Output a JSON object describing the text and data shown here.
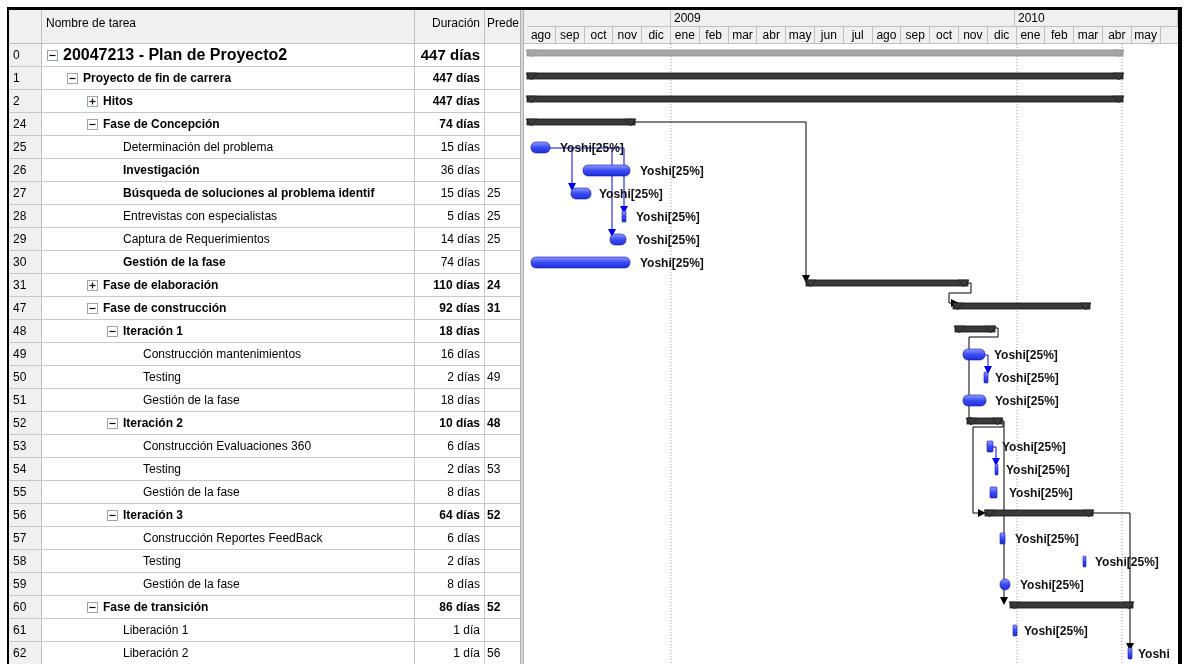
{
  "columns": [
    {
      "label": "Nombre de tarea"
    },
    {
      "label": "Duración"
    },
    {
      "label": "Prede"
    }
  ],
  "timescale": {
    "years": [
      "2009",
      "2010"
    ],
    "months": [
      "ago",
      "sep",
      "oct",
      "nov",
      "dic",
      "ene",
      "feb",
      "mar",
      "abr",
      "may",
      "jun",
      "jul",
      "ago",
      "sep",
      "oct",
      "nov",
      "dic",
      "ene",
      "feb",
      "mar",
      "abr",
      "may"
    ]
  },
  "tasks": [
    {
      "id": "0",
      "name": "20047213 - Plan de Proyecto2",
      "duration": "447 días",
      "kind": "project",
      "expanded": true,
      "children": [
        {
          "id": "1",
          "name": "Proyecto de fin de carrera",
          "duration": "447 días",
          "kind": "summary",
          "expanded": true,
          "children": [
            {
              "id": "2",
              "name": "Hitos",
              "duration": "447 días",
              "kind": "summary",
              "expanded": false
            },
            {
              "id": "24",
              "name": "Fase de Concepción",
              "duration": "74 días",
              "kind": "summary",
              "expanded": true,
              "children": [
                {
                  "id": "25",
                  "name": "Determinación del problema",
                  "duration": "15 días",
                  "kind": "task",
                  "emphasized": false,
                  "resource": "Yoshi[25%]"
                },
                {
                  "id": "26",
                  "name": "Investigación",
                  "duration": "36 días",
                  "kind": "task",
                  "emphasized": true,
                  "resource": "Yoshi[25%]"
                },
                {
                  "id": "27",
                  "name": "Búsqueda de soluciones al problema identif",
                  "duration": "15 días",
                  "predecessors": "25",
                  "kind": "task",
                  "emphasized": true,
                  "resource": "Yoshi[25%]"
                },
                {
                  "id": "28",
                  "name": "Entrevistas con especialistas",
                  "duration": "5 días",
                  "predecessors": "25",
                  "kind": "task",
                  "emphasized": false,
                  "resource": "Yoshi[25%]"
                },
                {
                  "id": "29",
                  "name": "Captura de Requerimientos",
                  "duration": "14 días",
                  "predecessors": "25",
                  "kind": "task",
                  "emphasized": false,
                  "resource": "Yoshi[25%]"
                },
                {
                  "id": "30",
                  "name": "Gestión de la fase",
                  "duration": "74 días",
                  "kind": "task",
                  "emphasized": true,
                  "resource": "Yoshi[25%]"
                }
              ]
            },
            {
              "id": "31",
              "name": "Fase de elaboración",
              "duration": "110 días",
              "predecessors": "24",
              "kind": "summary",
              "expanded": false
            },
            {
              "id": "47",
              "name": "Fase de construcción",
              "duration": "92 días",
              "predecessors": "31",
              "kind": "summary",
              "expanded": true,
              "children": [
                {
                  "id": "48",
                  "name": "Iteración 1",
                  "duration": "18 días",
                  "kind": "summary",
                  "expanded": true,
                  "children": [
                    {
                      "id": "49",
                      "name": "Construcción mantenimientos",
                      "duration": "16 días",
                      "kind": "task",
                      "emphasized": false,
                      "resource": "Yoshi[25%]"
                    },
                    {
                      "id": "50",
                      "name": "Testing",
                      "duration": "2 días",
                      "predecessors": "49",
                      "kind": "task",
                      "emphasized": false,
                      "resource": "Yoshi[25%]"
                    },
                    {
                      "id": "51",
                      "name": "Gestión de la fase",
                      "duration": "18 días",
                      "kind": "task",
                      "emphasized": false,
                      "resource": "Yoshi[25%]"
                    }
                  ]
                },
                {
                  "id": "52",
                  "name": "Iteración 2",
                  "duration": "10 días",
                  "predecessors": "48",
                  "kind": "summary",
                  "expanded": true,
                  "children": [
                    {
                      "id": "53",
                      "name": "Construcción Evaluaciones 360",
                      "duration": "6 días",
                      "kind": "task",
                      "emphasized": false,
                      "resource": "Yoshi[25%]"
                    },
                    {
                      "id": "54",
                      "name": "Testing",
                      "duration": "2 días",
                      "predecessors": "53",
                      "kind": "task",
                      "emphasized": false,
                      "resource": "Yoshi[25%]"
                    },
                    {
                      "id": "55",
                      "name": "Gestión de la fase",
                      "duration": "8 días",
                      "kind": "task",
                      "emphasized": false,
                      "resource": "Yoshi[25%]"
                    }
                  ]
                },
                {
                  "id": "56",
                  "name": "Iteración 3",
                  "duration": "64 días",
                  "predecessors": "52",
                  "kind": "summary",
                  "expanded": true,
                  "children": [
                    {
                      "id": "57",
                      "name": "Construcción Reportes FeedBack",
                      "duration": "6 días",
                      "kind": "task",
                      "emphasized": false,
                      "resource": "Yoshi[25%]"
                    },
                    {
                      "id": "58",
                      "name": "Testing",
                      "duration": "2 días",
                      "kind": "task",
                      "emphasized": false,
                      "resource": "Yoshi[25%]"
                    },
                    {
                      "id": "59",
                      "name": "Gestión de la fase",
                      "duration": "8 días",
                      "kind": "task",
                      "emphasized": false,
                      "resource": "Yoshi[25%]"
                    }
                  ]
                }
              ]
            },
            {
              "id": "60",
              "name": "Fase de transición",
              "duration": "86 días",
              "predecessors": "52",
              "kind": "summary",
              "expanded": true,
              "children": [
                {
                  "id": "61",
                  "name": "Liberación 1",
                  "duration": "1 día",
                  "kind": "task",
                  "emphasized": false,
                  "resource": "Yoshi[25%]"
                },
                {
                  "id": "62",
                  "name": "Liberación 2",
                  "duration": "1 día",
                  "predecessors": "56",
                  "kind": "task",
                  "emphasized": false,
                  "resource": "Yoshi"
                }
              ]
            }
          ]
        }
      ]
    }
  ]
}
